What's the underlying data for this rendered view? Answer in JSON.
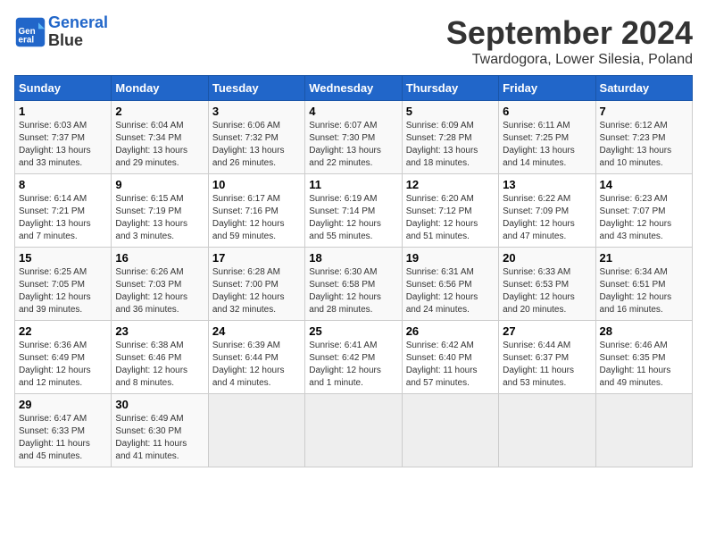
{
  "header": {
    "logo_line1": "General",
    "logo_line2": "Blue",
    "month": "September 2024",
    "location": "Twardogora, Lower Silesia, Poland"
  },
  "weekdays": [
    "Sunday",
    "Monday",
    "Tuesday",
    "Wednesday",
    "Thursday",
    "Friday",
    "Saturday"
  ],
  "weeks": [
    [
      {
        "day": "1",
        "info": "Sunrise: 6:03 AM\nSunset: 7:37 PM\nDaylight: 13 hours\nand 33 minutes."
      },
      {
        "day": "2",
        "info": "Sunrise: 6:04 AM\nSunset: 7:34 PM\nDaylight: 13 hours\nand 29 minutes."
      },
      {
        "day": "3",
        "info": "Sunrise: 6:06 AM\nSunset: 7:32 PM\nDaylight: 13 hours\nand 26 minutes."
      },
      {
        "day": "4",
        "info": "Sunrise: 6:07 AM\nSunset: 7:30 PM\nDaylight: 13 hours\nand 22 minutes."
      },
      {
        "day": "5",
        "info": "Sunrise: 6:09 AM\nSunset: 7:28 PM\nDaylight: 13 hours\nand 18 minutes."
      },
      {
        "day": "6",
        "info": "Sunrise: 6:11 AM\nSunset: 7:25 PM\nDaylight: 13 hours\nand 14 minutes."
      },
      {
        "day": "7",
        "info": "Sunrise: 6:12 AM\nSunset: 7:23 PM\nDaylight: 13 hours\nand 10 minutes."
      }
    ],
    [
      {
        "day": "8",
        "info": "Sunrise: 6:14 AM\nSunset: 7:21 PM\nDaylight: 13 hours\nand 7 minutes."
      },
      {
        "day": "9",
        "info": "Sunrise: 6:15 AM\nSunset: 7:19 PM\nDaylight: 13 hours\nand 3 minutes."
      },
      {
        "day": "10",
        "info": "Sunrise: 6:17 AM\nSunset: 7:16 PM\nDaylight: 12 hours\nand 59 minutes."
      },
      {
        "day": "11",
        "info": "Sunrise: 6:19 AM\nSunset: 7:14 PM\nDaylight: 12 hours\nand 55 minutes."
      },
      {
        "day": "12",
        "info": "Sunrise: 6:20 AM\nSunset: 7:12 PM\nDaylight: 12 hours\nand 51 minutes."
      },
      {
        "day": "13",
        "info": "Sunrise: 6:22 AM\nSunset: 7:09 PM\nDaylight: 12 hours\nand 47 minutes."
      },
      {
        "day": "14",
        "info": "Sunrise: 6:23 AM\nSunset: 7:07 PM\nDaylight: 12 hours\nand 43 minutes."
      }
    ],
    [
      {
        "day": "15",
        "info": "Sunrise: 6:25 AM\nSunset: 7:05 PM\nDaylight: 12 hours\nand 39 minutes."
      },
      {
        "day": "16",
        "info": "Sunrise: 6:26 AM\nSunset: 7:03 PM\nDaylight: 12 hours\nand 36 minutes."
      },
      {
        "day": "17",
        "info": "Sunrise: 6:28 AM\nSunset: 7:00 PM\nDaylight: 12 hours\nand 32 minutes."
      },
      {
        "day": "18",
        "info": "Sunrise: 6:30 AM\nSunset: 6:58 PM\nDaylight: 12 hours\nand 28 minutes."
      },
      {
        "day": "19",
        "info": "Sunrise: 6:31 AM\nSunset: 6:56 PM\nDaylight: 12 hours\nand 24 minutes."
      },
      {
        "day": "20",
        "info": "Sunrise: 6:33 AM\nSunset: 6:53 PM\nDaylight: 12 hours\nand 20 minutes."
      },
      {
        "day": "21",
        "info": "Sunrise: 6:34 AM\nSunset: 6:51 PM\nDaylight: 12 hours\nand 16 minutes."
      }
    ],
    [
      {
        "day": "22",
        "info": "Sunrise: 6:36 AM\nSunset: 6:49 PM\nDaylight: 12 hours\nand 12 minutes."
      },
      {
        "day": "23",
        "info": "Sunrise: 6:38 AM\nSunset: 6:46 PM\nDaylight: 12 hours\nand 8 minutes."
      },
      {
        "day": "24",
        "info": "Sunrise: 6:39 AM\nSunset: 6:44 PM\nDaylight: 12 hours\nand 4 minutes."
      },
      {
        "day": "25",
        "info": "Sunrise: 6:41 AM\nSunset: 6:42 PM\nDaylight: 12 hours\nand 1 minute."
      },
      {
        "day": "26",
        "info": "Sunrise: 6:42 AM\nSunset: 6:40 PM\nDaylight: 11 hours\nand 57 minutes."
      },
      {
        "day": "27",
        "info": "Sunrise: 6:44 AM\nSunset: 6:37 PM\nDaylight: 11 hours\nand 53 minutes."
      },
      {
        "day": "28",
        "info": "Sunrise: 6:46 AM\nSunset: 6:35 PM\nDaylight: 11 hours\nand 49 minutes."
      }
    ],
    [
      {
        "day": "29",
        "info": "Sunrise: 6:47 AM\nSunset: 6:33 PM\nDaylight: 11 hours\nand 45 minutes."
      },
      {
        "day": "30",
        "info": "Sunrise: 6:49 AM\nSunset: 6:30 PM\nDaylight: 11 hours\nand 41 minutes."
      },
      {
        "day": "",
        "info": ""
      },
      {
        "day": "",
        "info": ""
      },
      {
        "day": "",
        "info": ""
      },
      {
        "day": "",
        "info": ""
      },
      {
        "day": "",
        "info": ""
      }
    ]
  ]
}
